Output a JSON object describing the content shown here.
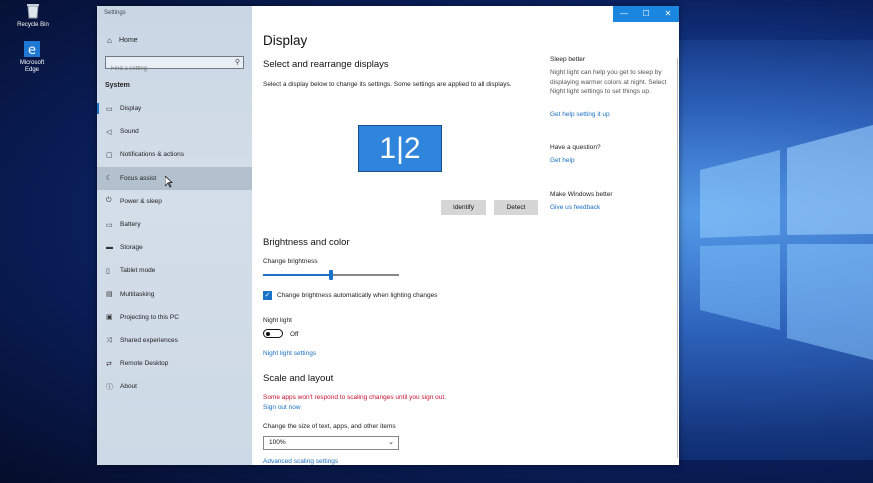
{
  "desktop": {
    "recycle_bin": "Recycle Bin",
    "edge": "Microsoft Edge"
  },
  "window": {
    "title": "Settings",
    "minimize": "—",
    "maximize": "☐",
    "close": "✕"
  },
  "sidebar": {
    "home": "Home",
    "search_placeholder": "Find a setting",
    "section": "System",
    "items": [
      {
        "label": "Display",
        "icon": "monitor-icon"
      },
      {
        "label": "Sound",
        "icon": "speaker-icon"
      },
      {
        "label": "Notifications & actions",
        "icon": "notification-icon"
      },
      {
        "label": "Focus assist",
        "icon": "moon-icon"
      },
      {
        "label": "Power & sleep",
        "icon": "power-icon"
      },
      {
        "label": "Battery",
        "icon": "battery-icon"
      },
      {
        "label": "Storage",
        "icon": "storage-icon"
      },
      {
        "label": "Tablet mode",
        "icon": "tablet-icon"
      },
      {
        "label": "Multitasking",
        "icon": "multitasking-icon"
      },
      {
        "label": "Projecting to this PC",
        "icon": "projecting-icon"
      },
      {
        "label": "Shared experiences",
        "icon": "shared-icon"
      },
      {
        "label": "Remote Desktop",
        "icon": "remote-icon"
      },
      {
        "label": "About",
        "icon": "info-icon"
      }
    ]
  },
  "main": {
    "page_title": "Display",
    "rearrange": {
      "heading": "Select and rearrange displays",
      "description": "Select a display below to change its settings. Some settings are applied to all displays.",
      "monitor_label": "1|2",
      "identify": "Identify",
      "detect": "Detect"
    },
    "brightness": {
      "heading": "Brightness and color",
      "change_label": "Change brightness",
      "value": 0.5,
      "auto_label": "Change brightness automatically when lighting changes",
      "auto_checked": true,
      "night_light_label": "Night light",
      "night_light_state": "Off",
      "night_light_settings": "Night light settings"
    },
    "scale": {
      "heading": "Scale and layout",
      "warning": "Some apps won't respond to scaling changes until you sign out.",
      "sign_out": "Sign out now",
      "size_label": "Change the size of text, apps, and other items",
      "size_value": "100%",
      "advanced": "Advanced scaling settings"
    }
  },
  "aside": {
    "sleep": {
      "heading": "Sleep better",
      "text": "Night light can help you get to sleep by displaying warmer colors at night. Select Night light settings to set things up.",
      "link": "Get help setting it up"
    },
    "question": {
      "heading": "Have a question?",
      "link": "Get help"
    },
    "better": {
      "heading": "Make Windows better",
      "link": "Give us feedback"
    }
  },
  "colors": {
    "accent": "#1a73c8",
    "warning": "#c8102e"
  }
}
